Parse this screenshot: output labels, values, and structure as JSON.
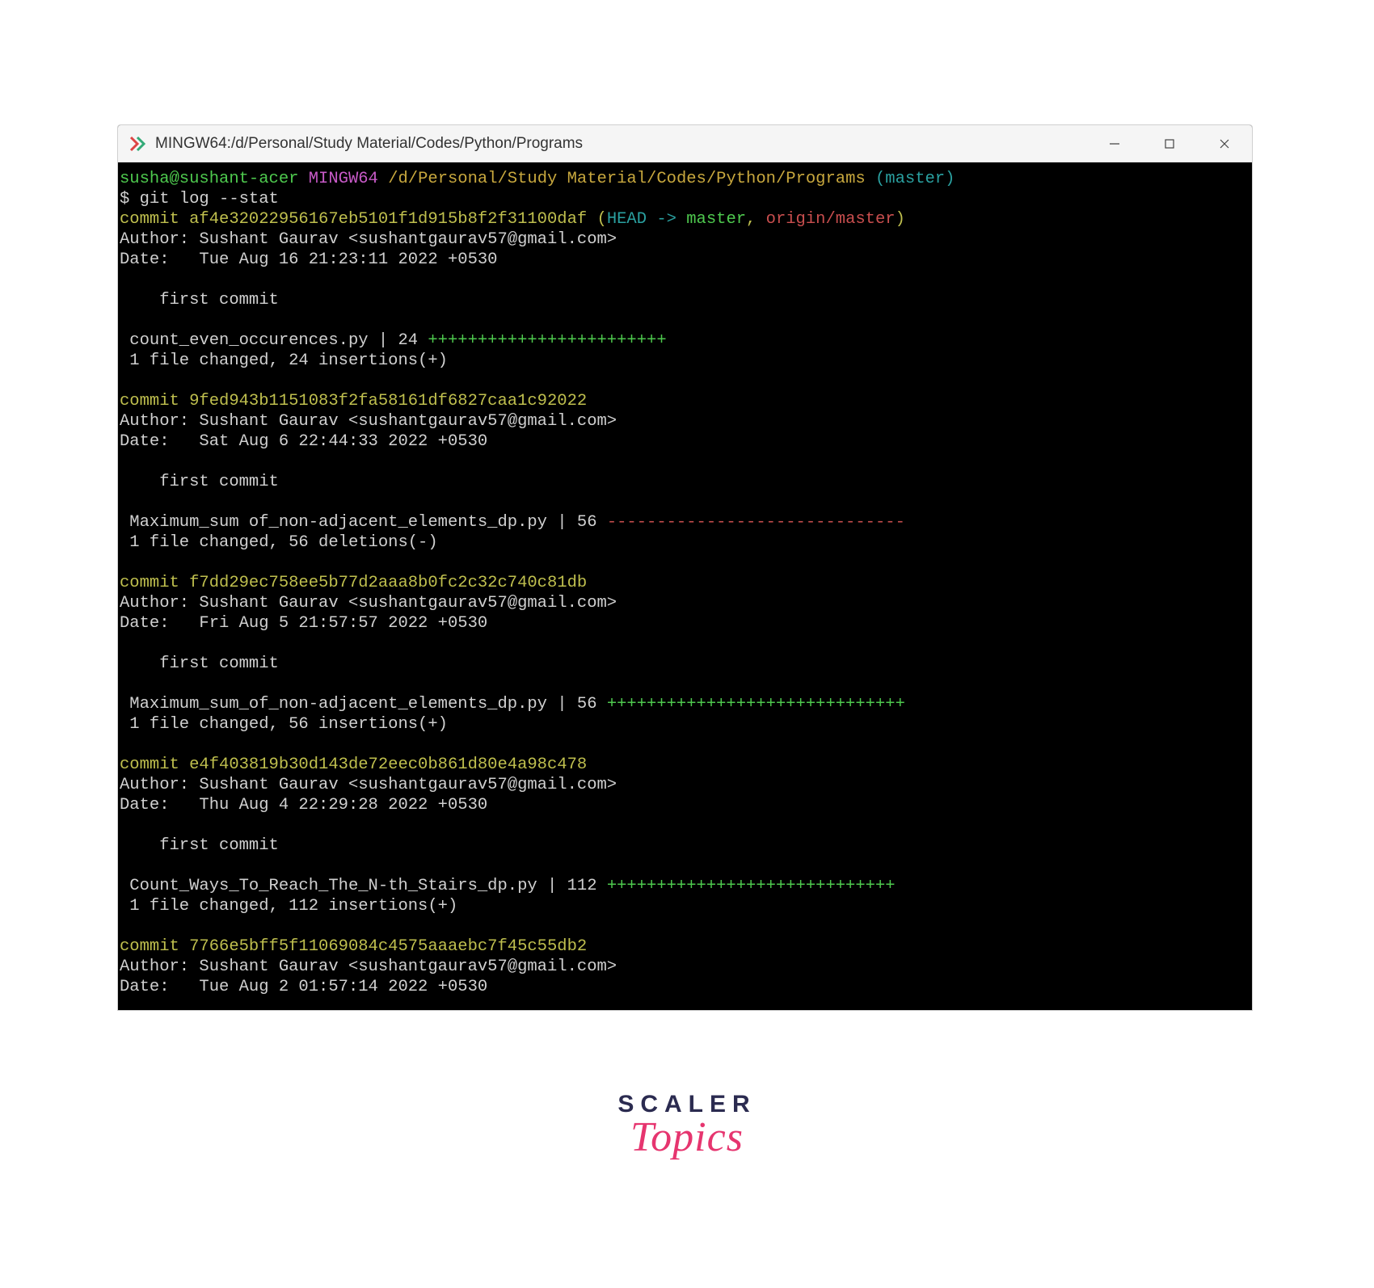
{
  "window": {
    "title": "MINGW64:/d/Personal/Study Material/Codes/Python/Programs"
  },
  "prompt": {
    "user": "susha@sushant-acer",
    "env": "MINGW64",
    "path": "/d/Personal/Study Material/Codes/Python/Programs",
    "branch": "(master)",
    "command": "$ git log --stat"
  },
  "commits": [
    {
      "hash": "commit af4e32022956167eb5101f1d915b8f2f31100daf",
      "refs_open": " (",
      "head": "HEAD -> ",
      "local_branch": "master",
      "sep": ", ",
      "remote_branch": "origin/master",
      "refs_close": ")",
      "author": "Author: Sushant Gaurav <sushantgaurav57@gmail.com>",
      "date": "Date:   Tue Aug 16 21:23:11 2022 +0530",
      "message": "    first commit",
      "stat_file": " count_even_occurences.py | 24 ",
      "stat_diff": "++++++++++++++++++++++++",
      "stat_diff_type": "ins",
      "stat_summary": " 1 file changed, 24 insertions(+)"
    },
    {
      "hash": "commit 9fed943b1151083f2fa58161df6827caa1c92022",
      "author": "Author: Sushant Gaurav <sushantgaurav57@gmail.com>",
      "date": "Date:   Sat Aug 6 22:44:33 2022 +0530",
      "message": "    first commit",
      "stat_file": " Maximum_sum of_non-adjacent_elements_dp.py | 56 ",
      "stat_diff": "------------------------------",
      "stat_diff_type": "del",
      "stat_summary": " 1 file changed, 56 deletions(-)"
    },
    {
      "hash": "commit f7dd29ec758ee5b77d2aaa8b0fc2c32c740c81db",
      "author": "Author: Sushant Gaurav <sushantgaurav57@gmail.com>",
      "date": "Date:   Fri Aug 5 21:57:57 2022 +0530",
      "message": "    first commit",
      "stat_file": " Maximum_sum_of_non-adjacent_elements_dp.py | 56 ",
      "stat_diff": "++++++++++++++++++++++++++++++",
      "stat_diff_type": "ins",
      "stat_summary": " 1 file changed, 56 insertions(+)"
    },
    {
      "hash": "commit e4f403819b30d143de72eec0b861d80e4a98c478",
      "author": "Author: Sushant Gaurav <sushantgaurav57@gmail.com>",
      "date": "Date:   Thu Aug 4 22:29:28 2022 +0530",
      "message": "    first commit",
      "stat_file": " Count_Ways_To_Reach_The_N-th_Stairs_dp.py | 112 ",
      "stat_diff": "+++++++++++++++++++++++++++++",
      "stat_diff_type": "ins",
      "stat_summary": " 1 file changed, 112 insertions(+)"
    },
    {
      "hash": "commit 7766e5bff5f11069084c4575aaaebc7f45c55db2",
      "author": "Author: Sushant Gaurav <sushantgaurav57@gmail.com>",
      "date": "Date:   Tue Aug 2 01:57:14 2022 +0530"
    }
  ],
  "logo": {
    "line1": "SCALER",
    "line2": "Topics"
  }
}
